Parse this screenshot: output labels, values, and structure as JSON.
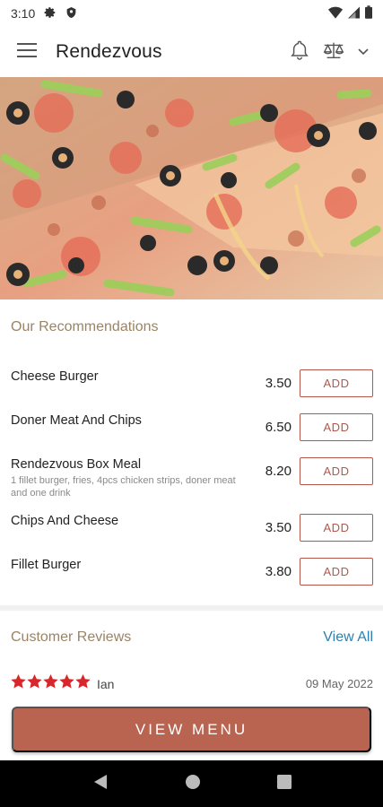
{
  "status": {
    "time": "3:10"
  },
  "app": {
    "title": "Rendezvous"
  },
  "recommendations": {
    "title": "Our Recommendations",
    "items": [
      {
        "name": "Cheese Burger",
        "description": "",
        "price": "3.50",
        "add_label": "ADD"
      },
      {
        "name": "Doner Meat And Chips",
        "description": "",
        "price": "6.50",
        "add_label": "ADD"
      },
      {
        "name": "Rendezvous Box Meal",
        "description": "1 fillet burger, fries, 4pcs chicken strips, doner meat and one drink",
        "price": "8.20",
        "add_label": "ADD"
      },
      {
        "name": "Chips And Cheese",
        "description": "",
        "price": "3.50",
        "add_label": "ADD"
      },
      {
        "name": "Fillet Burger",
        "description": "",
        "price": "3.80",
        "add_label": "ADD"
      }
    ]
  },
  "reviews": {
    "title": "Customer Reviews",
    "view_all_label": "View All",
    "items": [
      {
        "rating": 5,
        "name": "Ian",
        "date": "09 May 2022"
      }
    ]
  },
  "view_menu_label": "VIEW MENU",
  "colors": {
    "accent": "#b96450",
    "link": "#2f7fb0",
    "section_title": "#9a8466",
    "star": "#d8262b"
  },
  "icons": [
    "settings-icon",
    "shield-icon",
    "wifi-icon",
    "signal-icon",
    "battery-icon",
    "menu-icon",
    "bell-icon",
    "scale-icon",
    "chevron-down-icon",
    "star-icon",
    "back-icon",
    "home-icon",
    "recents-icon"
  ]
}
